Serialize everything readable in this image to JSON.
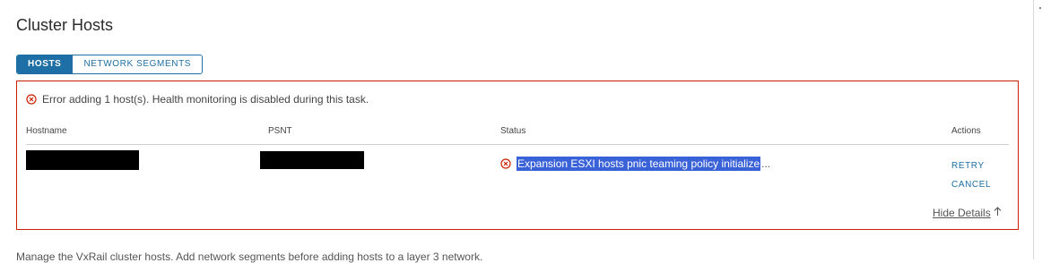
{
  "page": {
    "title": "Cluster Hosts",
    "footer_text": "Manage the VxRail cluster hosts. Add network segments before adding hosts to a layer 3 network."
  },
  "tabs": [
    {
      "label": "HOSTS",
      "active": true
    },
    {
      "label": "NETWORK SEGMENTS",
      "active": false
    }
  ],
  "panel": {
    "error_message": "Error adding 1 host(s). Health monitoring is disabled during this task.",
    "columns": {
      "hostname": "Hostname",
      "psnt": "PSNT",
      "status": "Status",
      "actions": "Actions"
    },
    "row": {
      "status_text": "Expansion ESXI hosts pnic teaming policy initialize",
      "status_ellipsis": "...",
      "retry_label": "RETRY",
      "cancel_label": "CANCEL"
    },
    "hide_details_label": "Hide Details"
  },
  "colors": {
    "accent": "#1d6fa5",
    "error": "#c92100",
    "selection": "#3a62d8"
  },
  "icons": {
    "error": "error-circle-icon",
    "hide": "arrow-up-icon"
  }
}
